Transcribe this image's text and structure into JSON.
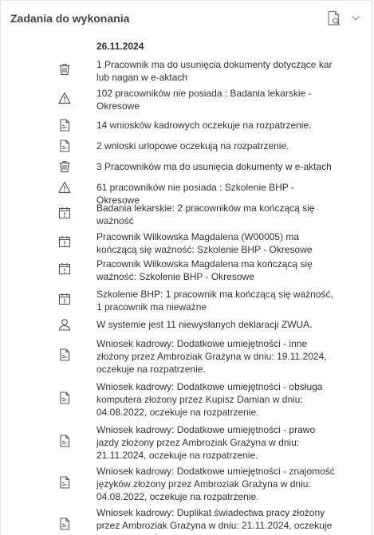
{
  "header": {
    "title": "Zadania do wykonania",
    "icons": [
      "document-search-icon",
      "chevron-down-icon"
    ]
  },
  "date": "26.11.2024",
  "items": [
    {
      "icon": "trash-icon",
      "text": "1 Pracownik ma do usunięcia dokumenty dotyczące kar lub nagan w e-aktach"
    },
    {
      "icon": "warning-icon",
      "text": "102 pracowników nie posiada : Badania lekarskie - Okresowe"
    },
    {
      "icon": "document-icon",
      "text": "14 wniosków kadrowych oczekuje na rozpatrzenie."
    },
    {
      "icon": "document-icon",
      "text": "2 wnioski urlopowe oczekują na rozpatrzenie."
    },
    {
      "icon": "trash-icon",
      "text": "3 Pracowników ma do usunięcia dokumenty w e-aktach"
    },
    {
      "icon": "warning-icon",
      "text": "61 pracowników nie posiada : Szkolenie BHP - Okresowe"
    },
    {
      "icon": "calendar-alert-icon",
      "text": "Badania lekarskie: 2 pracowników ma kończącą się ważność"
    },
    {
      "icon": "calendar-alert-icon",
      "text": "Pracownik Wilkowska Magdalena (W00005) ma kończącą się ważność: Szkolenie BHP - Okresowe"
    },
    {
      "icon": "calendar-alert-icon",
      "text": "Pracownik Wilkowska Magdalena ma kończącą się ważność: Szkolenie BHP - Okresowe"
    },
    {
      "icon": "calendar-alert-icon",
      "text": "Szkolenie BHP: 1 pracownik ma kończącą się ważność, 1 pracownik ma nieważne"
    },
    {
      "icon": "user-icon",
      "text": "W systemie jest 11 niewysłanych deklaracji ZWUA."
    },
    {
      "icon": "document-icon",
      "text": "Wniosek kadrowy: Dodatkowe umiejętności - inne złożony przez Ambroziak Grażyna w dniu: 19.11.2024, oczekuje na rozpatrzenie."
    },
    {
      "icon": "document-icon",
      "text": "Wniosek kadrowy: Dodatkowe umiejętności - obsługa komputera złożony przez Kupisz Damian w dniu: 04.08.2022, oczekuje na rozpatrzenie."
    },
    {
      "icon": "document-icon",
      "text": "Wniosek kadrowy: Dodatkowe umiejętności - prawo jazdy złożony przez Ambroziak Grażyna w dniu: 21.11.2024, oczekuje na rozpatrzenie."
    },
    {
      "icon": "document-icon",
      "text": "Wniosek kadrowy: Dodatkowe umiejętności - znajomość języków złożony przez Ambroziak Grażyna w dniu: 04.08.2022, oczekuje na rozpatrzenie."
    },
    {
      "icon": "document-icon",
      "text": "Wniosek kadrowy: Duplikat świadectwa pracy złożony przez Ambroziak Grażyna w dniu: 21.11.2024, oczekuje na rozpatrzenie."
    }
  ]
}
